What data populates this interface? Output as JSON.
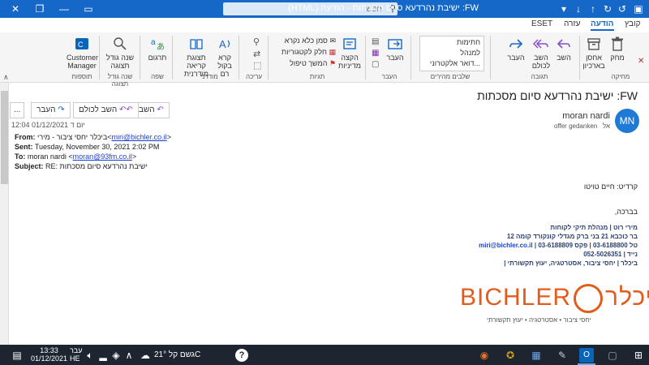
{
  "window": {
    "title": "FW: ישיבת נהרדעא סיום מסכתות - הודעה (HTML)",
    "search_placeholder": "חפש"
  },
  "tabs": [
    "קובץ",
    "הודעה",
    "עזרה",
    "ESET"
  ],
  "ribbon": {
    "delete": {
      "delete_label": "מחק",
      "archive_label": "אחסן בארכיון",
      "group": "מחיקה"
    },
    "respond": {
      "reply": "השב",
      "reply_all": "השב לכולם",
      "forward": "העבר",
      "group": "תגובה"
    },
    "quick_steps": {
      "items": [
        "חתימות",
        "למנהל",
        "דואר אלקטרוני..."
      ],
      "group": "שלבים מהירים"
    },
    "move": {
      "move": "העבר",
      "group": "העבר"
    },
    "tags": {
      "unread": "סמן כלא נקרא",
      "categorize": "חלק לקטגוריות",
      "followup": "המשך טיפול",
      "policy": "הקצה מדיניות",
      "group": "תגיות"
    },
    "editing": {
      "group": "עריכה"
    },
    "immersive": {
      "read_aloud": "קרא בקול רם",
      "immersive_reader": "תצוגת קריאה מודרנית",
      "group": "מודרני"
    },
    "language": {
      "translate": "תרגום",
      "group": "שפה"
    },
    "zoom": {
      "zoom": "שנה גודל תצוגה",
      "group": "שנה גודל תצוגה"
    },
    "addins": {
      "cm": "Customer Manager",
      "group": "תוספות"
    }
  },
  "message": {
    "subject": "FW: ישיבת נהרדעא סיום מסכתות",
    "sender": "moran nardi",
    "avatar_initials": "MN",
    "to_label": "אל",
    "to_name": "offer gedanken",
    "reply_button": "השב",
    "reply_all_button": "השב לכולם",
    "forward_button": "העבר",
    "more_button": "...",
    "date": "יום ד 01/12/2021 12:04",
    "fwd_from_label": "From:",
    "fwd_from_value": "ביכלר יחסי ציבור - מירי",
    "fwd_from_email": "miri@bichler.co.il",
    "fwd_sent_label": "Sent:",
    "fwd_sent_value": "Tuesday, November 30, 2021 2:02 PM",
    "fwd_to_label": "To:",
    "fwd_to_value": "moran nardi",
    "fwd_to_email": "moran@93fm.co.il",
    "fwd_subject_label": "Subject:",
    "fwd_subject_value": "RE: ישיבת נהרדעא סיום מסכתות",
    "credit": "קרדיט: חיים טויטו",
    "regards": "בברכה,",
    "sig_name": "מירי רוט | מנהלת תיקי לקוחות",
    "sig_address": "בר כוכבא 21 בני ברק מגדלי קונקורד קומה 12",
    "sig_phone": "טל 03-6188800 | פקס 03-6188809 |",
    "sig_email": "miri@bichler.co.il",
    "sig_mobile": "נייד | 052-5026351",
    "sig_tagline": "ביכלר | יחסי ציבור, אסטרטגיה, יעוץ תקשורתי |",
    "logo_text": "BICHLER",
    "logo_hebrew": "ביכלר",
    "logo_sub": "יחסי ציבור • אסטרטגיה • יעוץ תקשורתי"
  },
  "taskbar": {
    "weather": "גשם קל 21°C",
    "time": "13:33",
    "date": "01/12/2021",
    "lang": "עבר",
    "lang2": "HE"
  }
}
